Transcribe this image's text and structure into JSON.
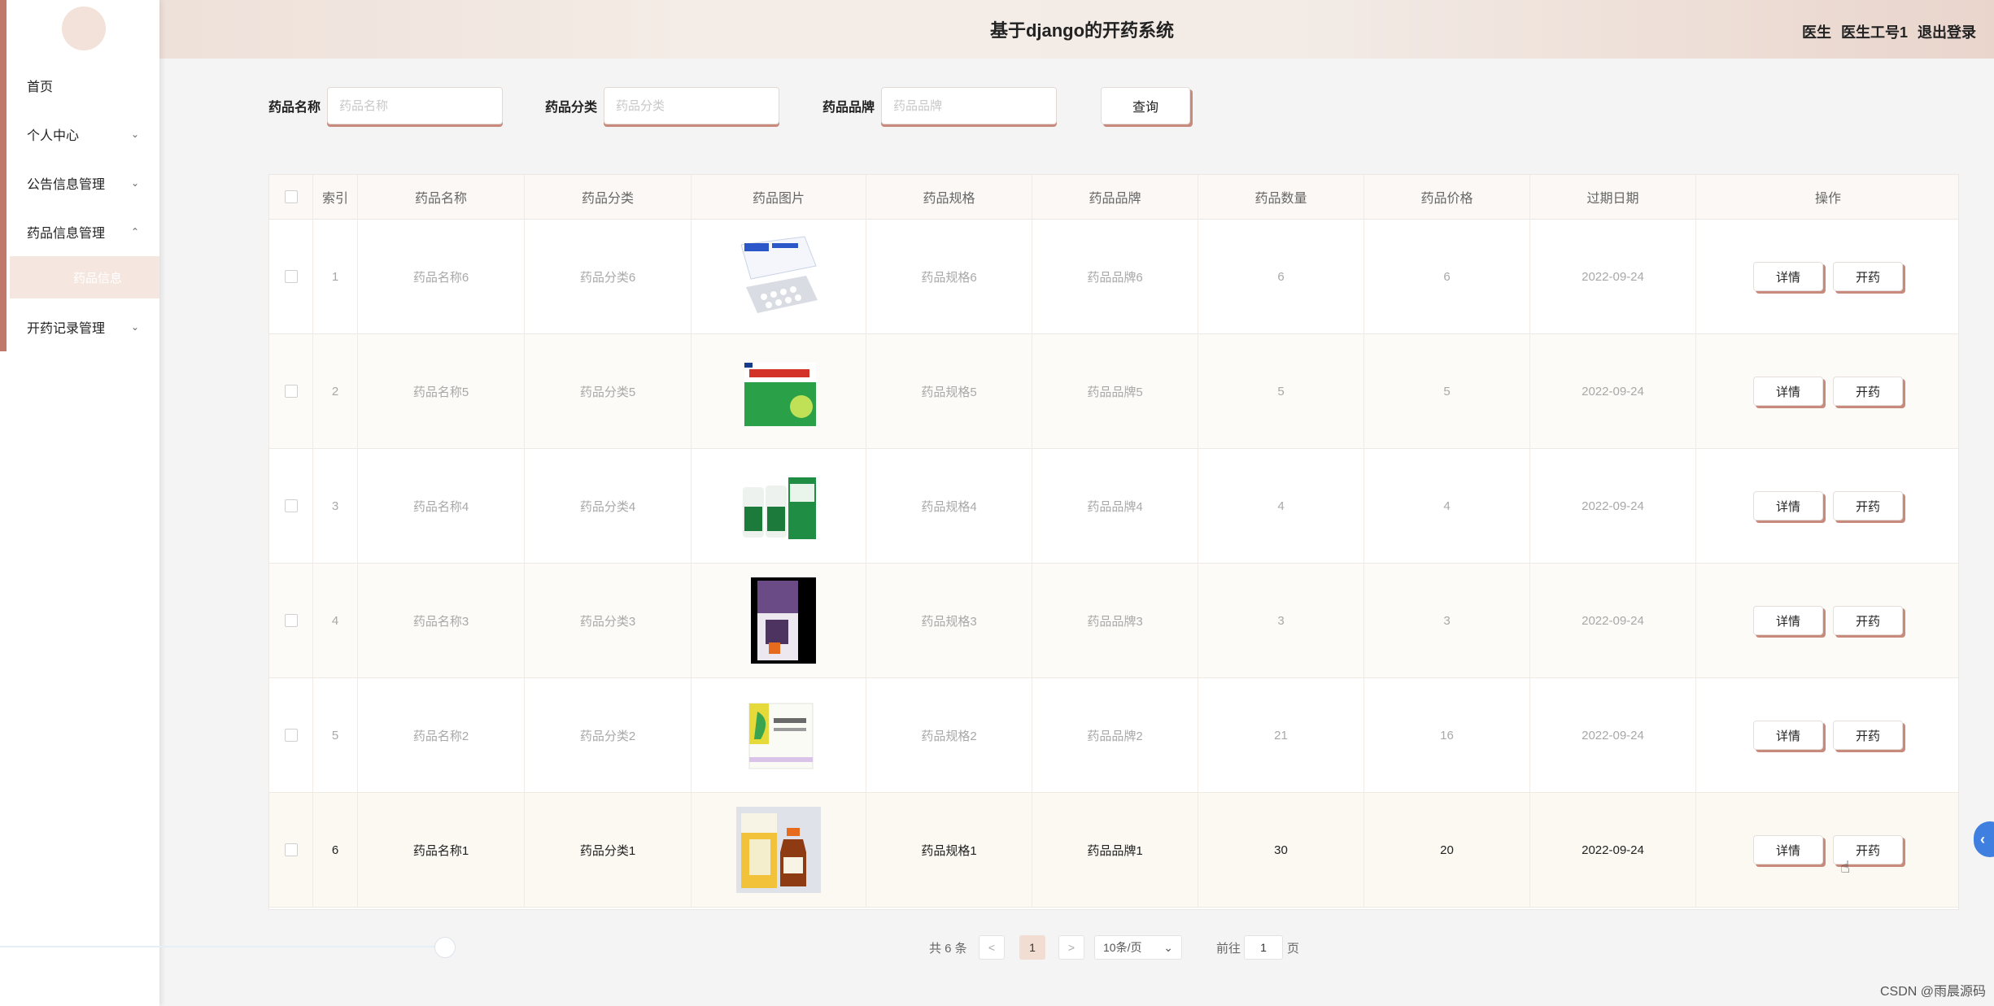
{
  "header": {
    "title": "基于django的开药系统",
    "user_role": "医生",
    "user_name": "医生工号1",
    "logout": "退出登录"
  },
  "sidebar": {
    "items": [
      {
        "label": "首页",
        "chevron": ""
      },
      {
        "label": "个人中心",
        "chevron": "⌄"
      },
      {
        "label": "公告信息管理",
        "chevron": "⌄"
      },
      {
        "label": "药品信息管理",
        "chevron": "⌃"
      },
      {
        "label": "开药记录管理",
        "chevron": "⌄"
      }
    ],
    "submenu_active": "药品信息"
  },
  "search": {
    "name_label": "药品名称",
    "name_placeholder": "药品名称",
    "category_label": "药品分类",
    "category_placeholder": "药品分类",
    "brand_label": "药品品牌",
    "brand_placeholder": "药品品牌",
    "query_button": "查询"
  },
  "table": {
    "headers": [
      "索引",
      "药品名称",
      "药品分类",
      "药品图片",
      "药品规格",
      "药品品牌",
      "药品数量",
      "药品价格",
      "过期日期",
      "操作"
    ],
    "rows": [
      {
        "index": "1",
        "name": "药品名称6",
        "category": "药品分类6",
        "spec": "药品规格6",
        "brand": "药品品牌6",
        "qty": "6",
        "price": "6",
        "expiry": "2022-09-24",
        "image": "medicine-box-blister-icon"
      },
      {
        "index": "2",
        "name": "药品名称5",
        "category": "药品分类5",
        "spec": "药品规格5",
        "brand": "药品品牌5",
        "qty": "5",
        "price": "5",
        "expiry": "2022-09-24",
        "image": "ganmao-granules-box-icon"
      },
      {
        "index": "3",
        "name": "药品名称4",
        "category": "药品分类4",
        "spec": "药品规格4",
        "brand": "药品品牌4",
        "qty": "4",
        "price": "4",
        "expiry": "2022-09-24",
        "image": "green-bottles-box-icon"
      },
      {
        "index": "4",
        "name": "药品名称3",
        "category": "药品分类3",
        "spec": "药品规格3",
        "brand": "药品品牌3",
        "qty": "3",
        "price": "3",
        "expiry": "2022-09-24",
        "image": "tall-purple-box-icon"
      },
      {
        "index": "5",
        "name": "药品名称2",
        "category": "药品分类2",
        "spec": "药品规格2",
        "brand": "药品品牌2",
        "qty": "21",
        "price": "16",
        "expiry": "2022-09-24",
        "image": "yellow-green-box-icon"
      },
      {
        "index": "6",
        "name": "药品名称1",
        "category": "药品分类1",
        "spec": "药品规格1",
        "brand": "药品品牌1",
        "qty": "30",
        "price": "20",
        "expiry": "2022-09-24",
        "image": "syrup-bottle-box-icon"
      }
    ],
    "detail_button": "详情",
    "prescribe_button": "开药"
  },
  "pagination": {
    "total": "共 6 条",
    "prev": "<",
    "current_page": "1",
    "next": ">",
    "page_size": "10条/页",
    "goto_label": "前往",
    "goto_value": "1",
    "page_suffix": "页"
  },
  "watermark": "CSDN @雨晨源码",
  "colors": {
    "accent": "#c88a7c",
    "sidebar_bar": "#c0786a",
    "active_bg": "#f1ddd2"
  }
}
